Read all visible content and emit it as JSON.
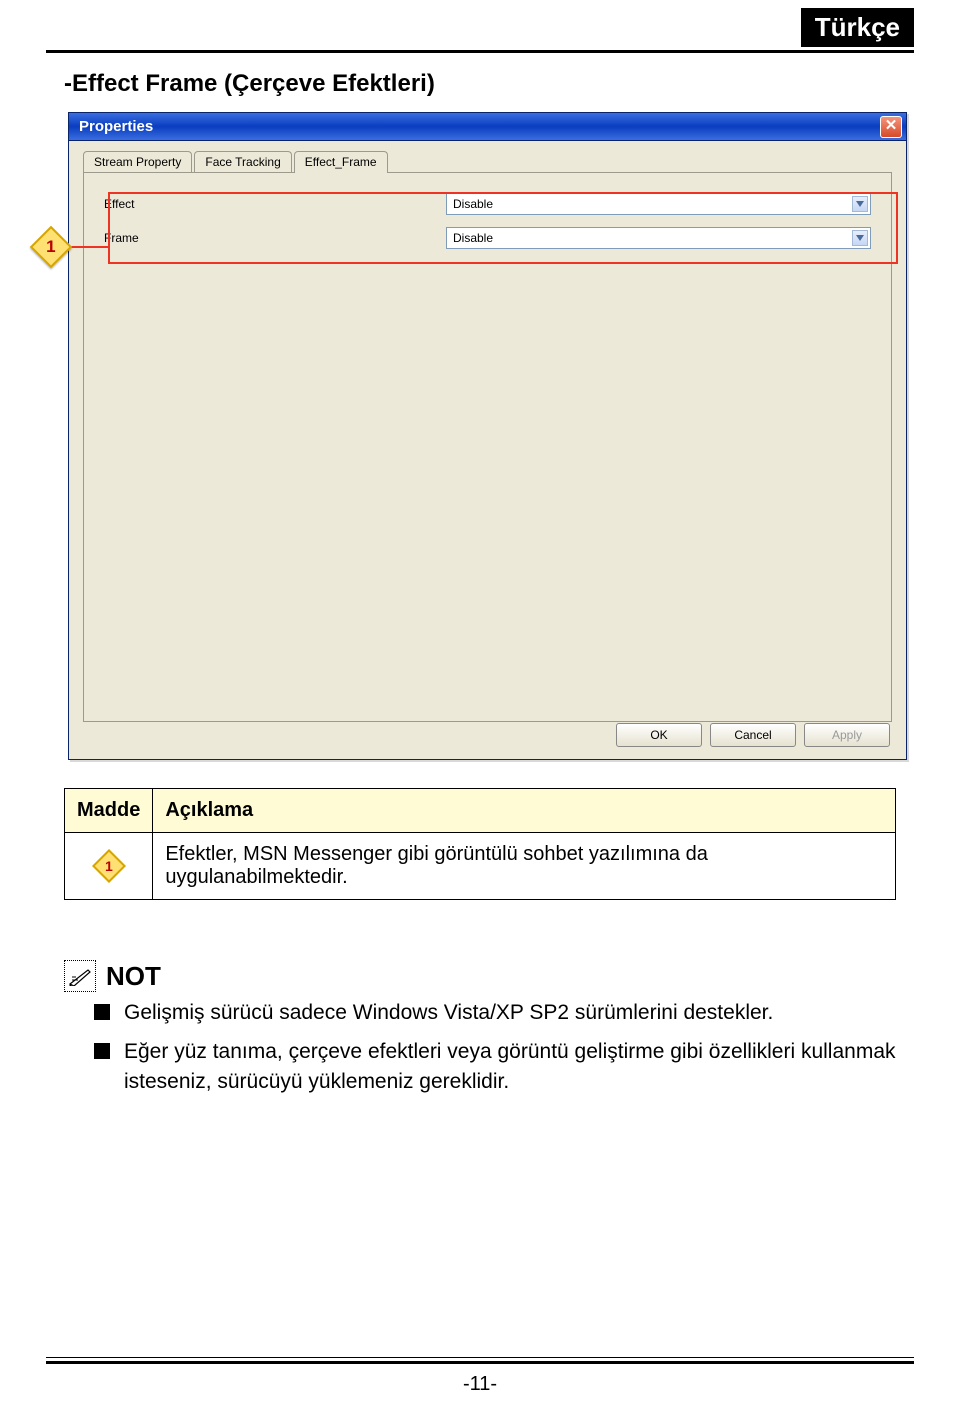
{
  "language_badge": "Türkçe",
  "section_title": "-Effect Frame (Çerçeve Efektleri)",
  "dialog": {
    "title": "Properties",
    "close_x": "✕",
    "tabs": [
      "Stream Property",
      "Face Tracking",
      "Effect_Frame"
    ],
    "active_tab_index": 2,
    "fields": [
      {
        "label": "Effect",
        "value": "Disable"
      },
      {
        "label": "Frame",
        "value": "Disable"
      }
    ],
    "buttons": {
      "ok": "OK",
      "cancel": "Cancel",
      "apply": "Apply"
    }
  },
  "callout_number": "1",
  "table": {
    "header_item": "Madde",
    "header_desc": "Açıklama",
    "row_desc": "Efektler, MSN Messenger gibi görüntülü sohbet yazılımına da uygulanabilmektedir."
  },
  "note": {
    "title": "NOT",
    "items": [
      "Gelişmiş sürücü sadece Windows Vista/XP SP2 sürümlerini destekler.",
      "Eğer yüz tanıma, çerçeve efektleri veya görüntü geliştirme gibi özellikleri kullanmak isteseniz, sürücüyü yüklemeniz gereklidir."
    ]
  },
  "page_number": "-11-"
}
